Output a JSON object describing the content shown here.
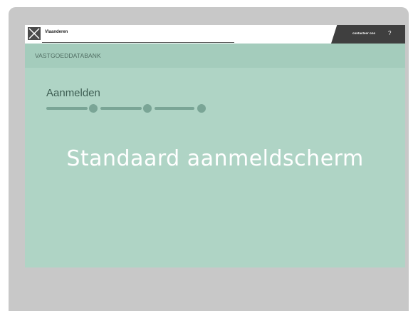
{
  "topbar": {
    "brand": "Vlaanderen",
    "contact_label": "contacteer ons",
    "help_icon": "?"
  },
  "subbar": {
    "title": "VASTGOEDDATABANK"
  },
  "login": {
    "title": "Aanmelden",
    "steps_total": 3
  },
  "main": {
    "headline": "Standaard aanmeldscherm"
  },
  "colors": {
    "screen_bg": "#afd4c5",
    "device_frame": "#c8c8c8",
    "dark_tab": "#3f3f3f",
    "stepper": "#7aa596"
  },
  "icons": {
    "logo": "vlaanderen-logo-icon",
    "help": "help-icon"
  }
}
